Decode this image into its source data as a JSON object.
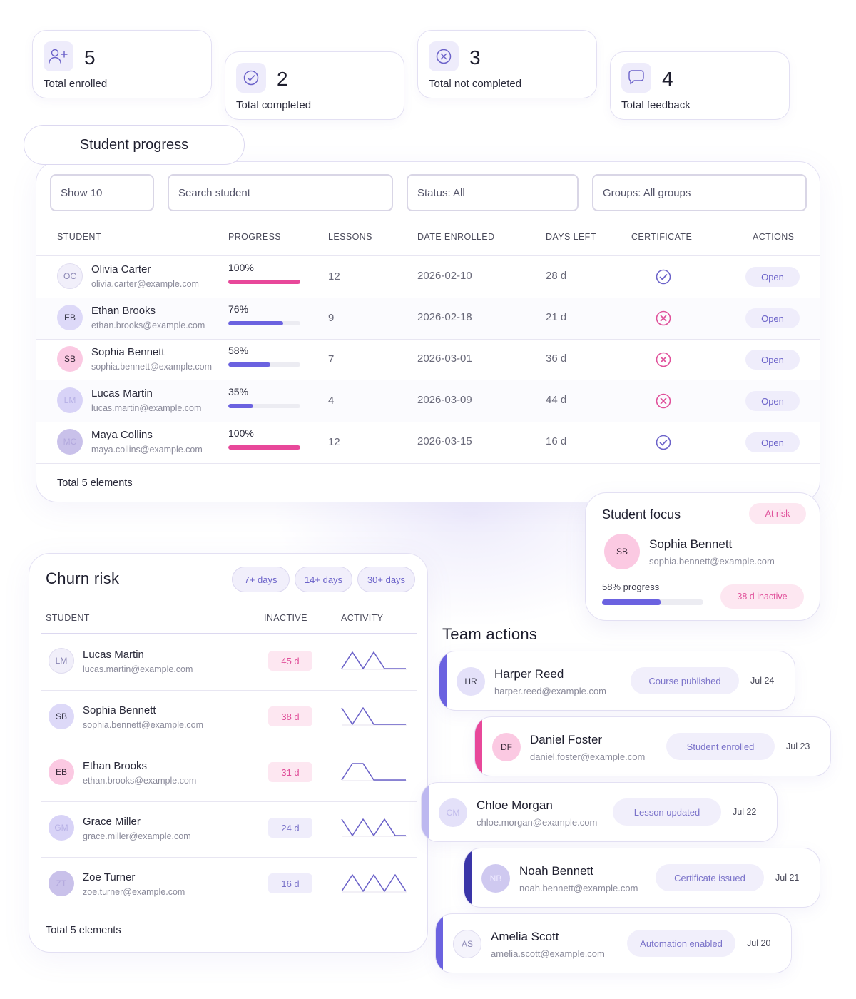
{
  "colors": {
    "accent": "#6b62e0",
    "pink": "#e8489a",
    "check": "#6b62c9",
    "cross": "#e0509a"
  },
  "stats": [
    {
      "icon": "add-user-icon",
      "value": "5",
      "label": "Total enrolled"
    },
    {
      "icon": "check-circle-icon",
      "value": "2",
      "label": "Total completed"
    },
    {
      "icon": "x-circle-icon",
      "value": "3",
      "label": "Total not completed"
    },
    {
      "icon": "chat-bubble-icon",
      "value": "4",
      "label": "Total feedback"
    }
  ],
  "progress": {
    "title": "Student progress",
    "filters": {
      "show": "Show 10",
      "search_placeholder": "Search student",
      "status": "Status: All",
      "groups": "Groups: All groups"
    },
    "headers": {
      "student": "STUDENT",
      "progress": "PROGRESS",
      "lessons": "LESSONS",
      "date": "DATE ENROLLED",
      "days": "DAYS LEFT",
      "certificate": "CERTIFICATE",
      "actions": "ACTIONS"
    },
    "rows": [
      {
        "initials": "OC",
        "name": "Olivia Carter",
        "email": "olivia.carter@example.com",
        "progress": "100%",
        "progress_value": 1.0,
        "lessons": "12",
        "date": "2026-02-10",
        "days": "28 d",
        "certificate": "issued",
        "action": "Open"
      },
      {
        "initials": "EB",
        "name": "Ethan Brooks",
        "email": "ethan.brooks@example.com",
        "progress": "76%",
        "progress_value": 0.76,
        "lessons": "9",
        "date": "2026-02-18",
        "days": "21 d",
        "certificate": "not-issued",
        "action": "Open"
      },
      {
        "initials": "SB",
        "name": "Sophia Bennett",
        "email": "sophia.bennett@example.com",
        "progress": "58%",
        "progress_value": 0.58,
        "lessons": "7",
        "date": "2026-03-01",
        "days": "36 d",
        "certificate": "not-issued",
        "action": "Open"
      },
      {
        "initials": "LM",
        "name": "Lucas Martin",
        "email": "lucas.martin@example.com",
        "progress": "35%",
        "progress_value": 0.35,
        "lessons": "4",
        "date": "2026-03-09",
        "days": "44 d",
        "certificate": "not-issued",
        "action": "Open"
      },
      {
        "initials": "MC",
        "name": "Maya Collins",
        "email": "maya.collins@example.com",
        "progress": "100%",
        "progress_value": 1.0,
        "lessons": "12",
        "date": "2026-03-15",
        "days": "16 d",
        "certificate": "issued",
        "action": "Open"
      }
    ],
    "total": "Total 5 elements"
  },
  "focus": {
    "title": "Student focus",
    "badge": "At risk",
    "initials": "SB",
    "name": "Sophia Bennett",
    "email": "sophia.bennett@example.com",
    "progress_label": "58% progress",
    "progress_value": 0.58,
    "inactive": "38 d inactive"
  },
  "churn": {
    "title": "Churn risk",
    "chips": [
      "7+ days",
      "14+ days",
      "30+ days"
    ],
    "headers": {
      "student": "STUDENT",
      "inactive": "INACTIVE",
      "activity": "ACTIVITY"
    },
    "rows": [
      {
        "initials": "LM",
        "name": "Lucas Martin",
        "email": "lucas.martin@example.com",
        "inactive": "45 d",
        "level": "high",
        "activity": [
          0,
          1,
          0,
          1,
          0,
          0,
          0
        ]
      },
      {
        "initials": "SB",
        "name": "Sophia Bennett",
        "email": "sophia.bennett@example.com",
        "inactive": "38 d",
        "level": "high",
        "activity": [
          1,
          0,
          1,
          0,
          0,
          0,
          0
        ]
      },
      {
        "initials": "EB",
        "name": "Ethan Brooks",
        "email": "ethan.brooks@example.com",
        "inactive": "31 d",
        "level": "high",
        "activity": [
          0,
          1,
          1,
          0,
          0,
          0,
          0
        ]
      },
      {
        "initials": "GM",
        "name": "Grace Miller",
        "email": "grace.miller@example.com",
        "inactive": "24 d",
        "level": "medium",
        "activity": [
          1,
          0,
          1,
          0,
          1,
          0,
          0
        ]
      },
      {
        "initials": "ZT",
        "name": "Zoe Turner",
        "email": "zoe.turner@example.com",
        "inactive": "16 d",
        "level": "medium",
        "activity": [
          0,
          1,
          0,
          1,
          0,
          1,
          0
        ]
      }
    ],
    "total": "Total 5 elements"
  },
  "team": {
    "title": "Team actions",
    "items": [
      {
        "initials": "HR",
        "name": "Harper Reed",
        "email": "harper.reed@example.com",
        "tag": "Course published",
        "date": "Jul 24"
      },
      {
        "initials": "DF",
        "name": "Daniel Foster",
        "email": "daniel.foster@example.com",
        "tag": "Student enrolled",
        "date": "Jul 23"
      },
      {
        "initials": "CM",
        "name": "Chloe Morgan",
        "email": "chloe.morgan@example.com",
        "tag": "Lesson updated",
        "date": "Jul 22"
      },
      {
        "initials": "NB",
        "name": "Noah Bennett",
        "email": "noah.bennett@example.com",
        "tag": "Certificate issued",
        "date": "Jul 21"
      },
      {
        "initials": "AS",
        "name": "Amelia Scott",
        "email": "amelia.scott@example.com",
        "tag": "Automation enabled",
        "date": "Jul 20"
      }
    ]
  }
}
